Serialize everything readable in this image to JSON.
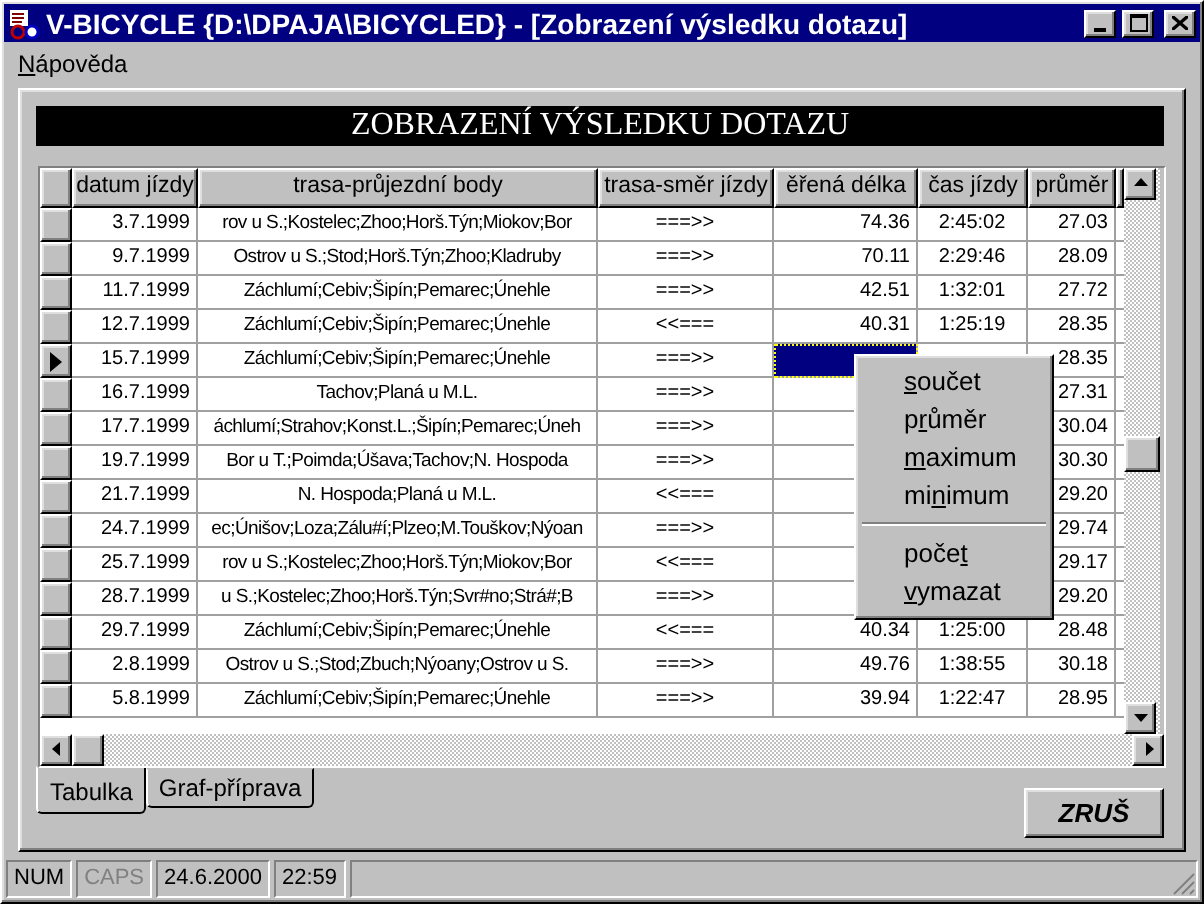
{
  "window": {
    "title": "V-BICYCLE {D:\\DPAJA\\BICYCLED}  - [Zobrazení výsledku dotazu]"
  },
  "menu_bar": [
    {
      "key": "N",
      "post": "ápověda"
    }
  ],
  "heading": "ZOBRAZENÍ VÝSLEDKU DOTAZU",
  "table": {
    "columns": [
      "datum jízdy",
      "trasa-průjezdní body",
      "trasa-směr jízdy",
      "ěřená délka",
      "čas jízdy",
      "průměr"
    ],
    "rows": [
      {
        "date": "3.7.1999",
        "route": "rov u S.;Kostelec;Zhoo;Horš.Týn;Miokov;Bor",
        "direction": "===>>",
        "length": "74.36",
        "time": "2:45:02",
        "average": "27.03",
        "current": false
      },
      {
        "date": "9.7.1999",
        "route": "Ostrov u S.;Stod;Horš.Týn;Zhoo;Kladruby",
        "direction": "===>>",
        "length": "70.11",
        "time": "2:29:46",
        "average": "28.09",
        "current": false
      },
      {
        "date": "11.7.1999",
        "route": "Záchlumí;Cebiv;Šipín;Pemarec;Únehle",
        "direction": "===>>",
        "length": "42.51",
        "time": "1:32:01",
        "average": "27.72",
        "current": false
      },
      {
        "date": "12.7.1999",
        "route": "Záchlumí;Cebiv;Šipín;Pemarec;Únehle",
        "direction": "<<===",
        "length": "40.31",
        "time": "1:25:19",
        "average": "28.35",
        "current": false
      },
      {
        "date": "15.7.1999",
        "route": "Záchlumí;Cebiv;Šipín;Pemarec;Únehle",
        "direction": "===>>",
        "average": "28.35",
        "current": true
      },
      {
        "date": "16.7.1999",
        "route": "Tachov;Planá u M.L.",
        "direction": "===>>",
        "average": "27.31",
        "current": false
      },
      {
        "date": "17.7.1999",
        "route": "áchlumí;Strahov;Konst.L.;Šipín;Pemarec;Úneh",
        "direction": "===>>",
        "average": "30.04",
        "current": false
      },
      {
        "date": "19.7.1999",
        "route": "Bor u T.;Poimda;Úšava;Tachov;N. Hospoda",
        "direction": "===>>",
        "average": "30.30",
        "current": false
      },
      {
        "date": "21.7.1999",
        "route": "N. Hospoda;Planá u M.L.",
        "direction": "<<===",
        "average": "29.20",
        "current": false
      },
      {
        "date": "24.7.1999",
        "route": "ec;Únišov;Loza;Zálu#í;Plzeo;M.Touškov;Nýoan",
        "direction": "===>>",
        "average": "29.74",
        "current": false
      },
      {
        "date": "25.7.1999",
        "route": "rov u S.;Kostelec;Zhoo;Horš.Týn;Miokov;Bor",
        "direction": "<<===",
        "average": "29.17",
        "current": false
      },
      {
        "date": "28.7.1999",
        "route": "u S.;Kostelec;Zhoo;Horš.Týn;Svr#no;Strá#;B",
        "direction": "===>>",
        "average": "29.20",
        "current": false
      },
      {
        "date": "29.7.1999",
        "route": "Záchlumí;Cebiv;Šipín;Pemarec;Únehle",
        "direction": "<<===",
        "length": "40.34",
        "time": "1:25:00",
        "average": "28.48",
        "current": false
      },
      {
        "date": "2.8.1999",
        "route": "Ostrov u S.;Stod;Zbuch;Nýoany;Ostrov u S.",
        "direction": "===>>",
        "length": "49.76",
        "time": "1:38:55",
        "average": "30.18",
        "current": false
      },
      {
        "date": "5.8.1999",
        "route": "Záchlumí;Cebiv;Šipín;Pemarec;Únehle",
        "direction": "===>>",
        "length": "39.94",
        "time": "1:22:47",
        "average": "28.95",
        "current": false
      }
    ]
  },
  "context_menu": {
    "groups": [
      [
        {
          "key": "s",
          "post": "oučet"
        },
        {
          "pre": "p",
          "key": "r",
          "post": "ůměr"
        },
        {
          "key": "m",
          "post": "aximum"
        },
        {
          "pre": "mi",
          "key": "n",
          "post": "imum"
        }
      ],
      [
        {
          "pre": "poče",
          "key": "t"
        },
        {
          "key": "v",
          "post": "ymazat"
        }
      ]
    ]
  },
  "tabs": [
    {
      "label": "Tabulka",
      "selected": true
    },
    {
      "label": "Graf-příprava",
      "selected": false
    }
  ],
  "cancel_button": "ZRUŠ",
  "status_bar": [
    {
      "text": "NUM",
      "disabled": false
    },
    {
      "text": "CAPS",
      "disabled": true
    },
    {
      "text": "24.6.2000",
      "disabled": false
    },
    {
      "text": "22:59",
      "disabled": false
    }
  ]
}
